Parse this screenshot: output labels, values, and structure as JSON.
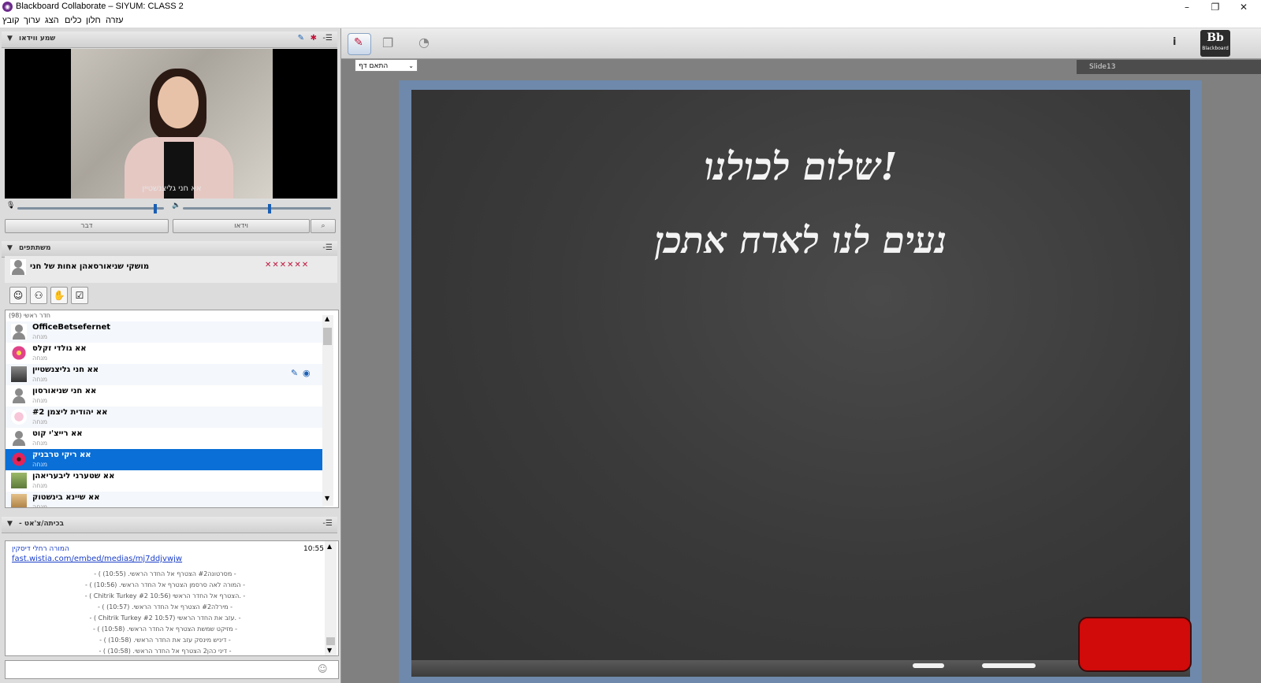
{
  "window": {
    "title": "Blackboard Collaborate – SIYUM: CLASS 2",
    "controls": [
      "–",
      "❐",
      "✕"
    ]
  },
  "menu": [
    "קובץ",
    "ערוך",
    "הצג",
    "כלים",
    "חלון",
    "עזרה"
  ],
  "video_panel": {
    "title": "שמע ווידאו",
    "caption": "אא חני גליצנשטיין",
    "talk_button": "דבר",
    "video_button": "וידאו"
  },
  "participants_panel": {
    "title": "משתתפים",
    "me": "מושקי שניאורסאהן אחות של חני",
    "room_label": "חדר ראשי",
    "room_count": "(98)",
    "items": [
      {
        "name": "OfficeBetsefernet",
        "role": "מנחה",
        "avatar": "gray"
      },
      {
        "name": "אא גולדי זקלס",
        "role": "מנחה",
        "avatar": "flower"
      },
      {
        "name": "אא חני גליצנשטיין",
        "role": "מנחה",
        "avatar": "photo"
      },
      {
        "name": "אא חני שניאורסון",
        "role": "מנחה",
        "avatar": "gray"
      },
      {
        "name": "אא יהודית ליצמן #2",
        "role": "מנחה",
        "avatar": "cartoon"
      },
      {
        "name": "אא רייצ'י קוט",
        "role": "מנחה",
        "avatar": "gray"
      },
      {
        "name": "אא ריקי טרבניק",
        "role": "מנחה",
        "avatar": "flower-red",
        "selected": true
      },
      {
        "name": "אא שטערני ליבעריאהן",
        "role": "מנחה",
        "avatar": "family"
      },
      {
        "name": "אא שיינא בינשטוק",
        "role": "מנחה",
        "avatar": "basket"
      }
    ]
  },
  "chat_panel": {
    "title": "- בכיתה/צ'אט",
    "author": "המורה רחלי דיסקין",
    "time": "10:55",
    "link": "fast.wistia.com/embed/medias/mj7ddjvwjw",
    "system_lines": [
      "- ( מסרטונה#2 הצטרף אל החדר הראשי. (10:55) -",
      "- ( המורה לאה סרסמן הצטרף אל החדר הראשי. (10:56) -",
      "- ( Chitrik Turkey #2 10:56) הצטרף אל החדר הראשי. -",
      "- ( מירלה#2 הצטרף אל החדר הראשי. (10:57) -",
      "- ( Chitrik Turkey #2 10:57) עזב את החדר הראשי. -",
      "- ( מזיקט שמשת הצטרף אל החדר הראשי. (10:58) -",
      "- ( דיניש מינסק עזב את החדר הראשי. (10:58) -",
      "- ( דיני כהן2 הצטרף אל החדר הראשי. (10:58) -"
    ]
  },
  "whiteboard": {
    "zoom": "התאם דף",
    "slide_name": "Slide13",
    "line1": "שלום לכולנו!",
    "line2": "נעים לנו לארח אתכן"
  },
  "info_glyph": "i",
  "brand": {
    "logo": "Bb",
    "label": "Blackboard"
  },
  "colors": {
    "selection": "#0a6fd6",
    "eraser": "#d10a0a",
    "link": "#1a3ec8"
  }
}
